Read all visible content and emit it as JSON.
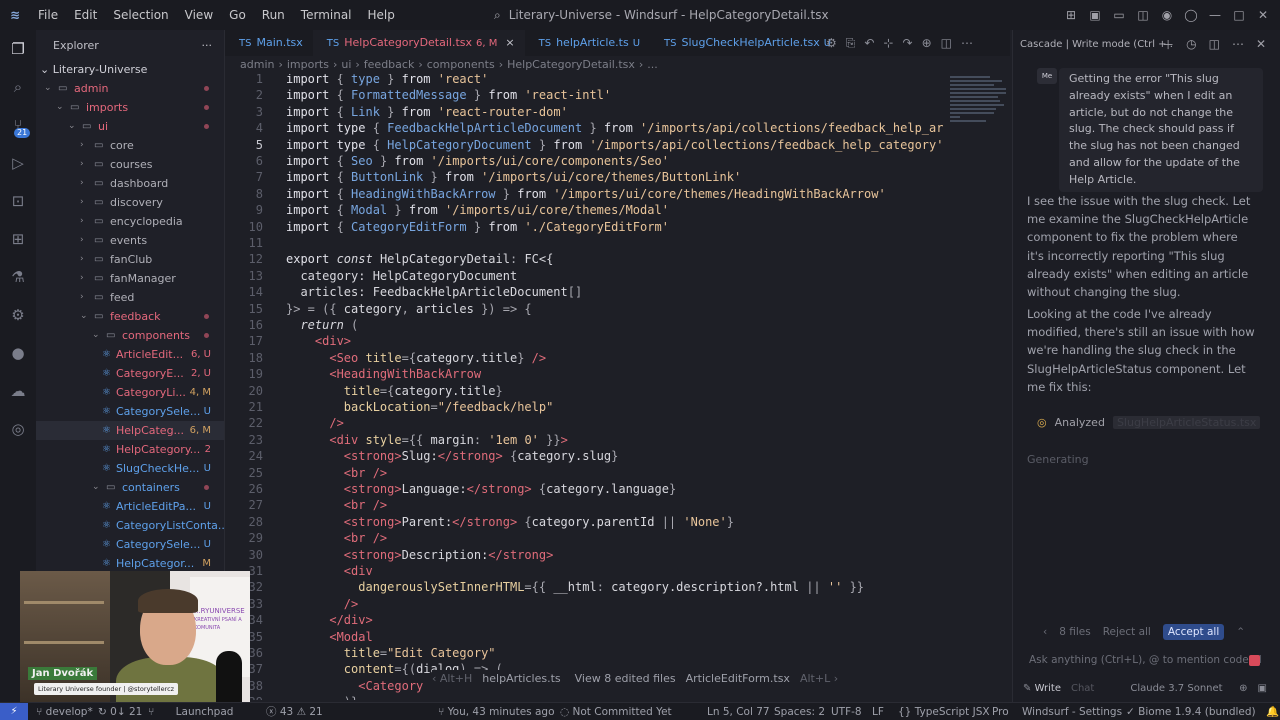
{
  "titlebar": {
    "menu": [
      "File",
      "Edit",
      "Selection",
      "View",
      "Go",
      "Run",
      "Terminal",
      "Help"
    ],
    "window_title": "Literary-Universe - Windsurf - HelpCategoryDetail.tsx"
  },
  "activity_bar": {
    "icons": [
      "explorer-icon",
      "search-icon",
      "source-control-icon",
      "run-debug-icon",
      "remote-icon",
      "extensions-icon",
      "testing-icon",
      "windsurf-icon",
      "github-icon",
      "docker-icon",
      "deploy-icon"
    ],
    "scm_badge": "21"
  },
  "sidebar": {
    "title": "Explorer",
    "more": "···",
    "project": "Literary-Universe",
    "tree": [
      {
        "label": "admin",
        "indent": 0,
        "type": "folder",
        "open": true,
        "color": "red",
        "dot": true
      },
      {
        "label": "imports",
        "indent": 1,
        "type": "folder",
        "open": true,
        "color": "red",
        "dot": true
      },
      {
        "label": "ui",
        "indent": 2,
        "type": "folder",
        "open": true,
        "color": "red",
        "dot": true
      },
      {
        "label": "core",
        "indent": 3,
        "type": "folder",
        "open": false,
        "color": "plain",
        "dot": false
      },
      {
        "label": "courses",
        "indent": 3,
        "type": "folder",
        "open": false,
        "color": "plain",
        "dot": false
      },
      {
        "label": "dashboard",
        "indent": 3,
        "type": "folder",
        "open": false,
        "color": "plain",
        "dot": false
      },
      {
        "label": "discovery",
        "indent": 3,
        "type": "folder",
        "open": false,
        "color": "plain",
        "dot": false
      },
      {
        "label": "encyclopedia",
        "indent": 3,
        "type": "folder",
        "open": false,
        "color": "plain",
        "dot": false
      },
      {
        "label": "events",
        "indent": 3,
        "type": "folder",
        "open": false,
        "color": "plain",
        "dot": false
      },
      {
        "label": "fanClub",
        "indent": 3,
        "type": "folder",
        "open": false,
        "color": "plain",
        "dot": false
      },
      {
        "label": "fanManager",
        "indent": 3,
        "type": "folder",
        "open": false,
        "color": "plain",
        "dot": false
      },
      {
        "label": "feed",
        "indent": 3,
        "type": "folder",
        "open": false,
        "color": "plain",
        "dot": false
      },
      {
        "label": "feedback",
        "indent": 3,
        "type": "folder",
        "open": true,
        "color": "red",
        "dot": true
      },
      {
        "label": "components",
        "indent": 4,
        "type": "folder",
        "open": true,
        "color": "red",
        "dot": true
      },
      {
        "label": "ArticleEdit...",
        "indent": 5,
        "type": "file",
        "color": "red",
        "status": "6, U"
      },
      {
        "label": "CategoryE...",
        "indent": 5,
        "type": "file",
        "color": "red",
        "status": "2, U"
      },
      {
        "label": "CategoryLi...",
        "indent": 5,
        "type": "file",
        "color": "red",
        "status": "4, M"
      },
      {
        "label": "CategorySele...",
        "indent": 5,
        "type": "file",
        "color": "blue",
        "status": "U"
      },
      {
        "label": "HelpCateg...",
        "indent": 5,
        "type": "file",
        "color": "red",
        "status": "6, M",
        "selected": true
      },
      {
        "label": "HelpCategory...",
        "indent": 5,
        "type": "file",
        "color": "red",
        "status": "2"
      },
      {
        "label": "SlugCheckHe...",
        "indent": 5,
        "type": "file",
        "color": "blue",
        "status": "U"
      },
      {
        "label": "containers",
        "indent": 4,
        "type": "folder",
        "open": true,
        "color": "blue",
        "dot": true
      },
      {
        "label": "ArticleEditPa...",
        "indent": 5,
        "type": "file",
        "color": "blue",
        "status": "U"
      },
      {
        "label": "CategoryListConta...",
        "indent": 5,
        "type": "file",
        "color": "blue",
        "status": ""
      },
      {
        "label": "CategorySele...",
        "indent": 5,
        "type": "file",
        "color": "blue",
        "status": "U"
      },
      {
        "label": "HelpCategor...",
        "indent": 5,
        "type": "file",
        "color": "blue",
        "status": "M"
      },
      {
        "label": "form",
        "indent": 4,
        "type": "folder",
        "open": false,
        "color": "plain",
        "dot": false
      }
    ]
  },
  "tabs": [
    {
      "label": "Main.tsx",
      "icon": "TS",
      "status": "",
      "active": false,
      "color": "blue"
    },
    {
      "label": "HelpCategoryDetail.tsx",
      "icon": "TS",
      "status": "6, M",
      "active": true,
      "color": "red",
      "close": "×"
    },
    {
      "label": "helpArticle.ts",
      "icon": "TS",
      "status": "U",
      "active": false,
      "color": "blue"
    },
    {
      "label": "SlugCheckHelpArticle.tsx",
      "icon": "TS",
      "status": "U",
      "active": false,
      "color": "blue"
    }
  ],
  "breadcrumb": [
    "admin",
    "imports",
    "ui",
    "feedback",
    "components",
    "HelpCategoryDetail.tsx",
    "..."
  ],
  "code_lines": [
    {
      "n": "1",
      "tokens": [
        [
          "kw",
          "import "
        ],
        [
          "pu",
          "{ "
        ],
        [
          "ty",
          "type"
        ],
        [
          "pu",
          " } "
        ],
        [
          "kw",
          "from "
        ],
        [
          "str",
          "'react'"
        ]
      ]
    },
    {
      "n": "2",
      "tokens": [
        [
          "kw",
          "import "
        ],
        [
          "pu",
          "{ "
        ],
        [
          "ty",
          "FormattedMessage"
        ],
        [
          "pu",
          " } "
        ],
        [
          "kw",
          "from "
        ],
        [
          "str",
          "'react-intl'"
        ]
      ]
    },
    {
      "n": "3",
      "tokens": [
        [
          "kw",
          "import "
        ],
        [
          "pu",
          "{ "
        ],
        [
          "ty",
          "Link"
        ],
        [
          "pu",
          " } "
        ],
        [
          "kw",
          "from "
        ],
        [
          "str",
          "'react-router-dom'"
        ]
      ]
    },
    {
      "n": "4",
      "tokens": [
        [
          "kw",
          "import type "
        ],
        [
          "pu",
          "{ "
        ],
        [
          "ty",
          "FeedbackHelpArticleDocument"
        ],
        [
          "pu",
          " } "
        ],
        [
          "kw",
          "from "
        ],
        [
          "str",
          "'/imports/api/collections/feedback_help_ar"
        ]
      ]
    },
    {
      "n": "5",
      "tokens": [
        [
          "kw",
          "import type "
        ],
        [
          "pu",
          "{ "
        ],
        [
          "ty",
          "HelpCategoryDocument"
        ],
        [
          "pu",
          " } "
        ],
        [
          "kw",
          "from "
        ],
        [
          "str",
          "'/imports/api/collections/feedback_help_category'"
        ]
      ],
      "cur": true
    },
    {
      "n": "6",
      "tokens": [
        [
          "kw",
          "import "
        ],
        [
          "pu",
          "{ "
        ],
        [
          "ty",
          "Seo"
        ],
        [
          "pu",
          " } "
        ],
        [
          "kw",
          "from "
        ],
        [
          "str",
          "'/imports/ui/core/components/Seo'"
        ]
      ]
    },
    {
      "n": "7",
      "tokens": [
        [
          "kw",
          "import "
        ],
        [
          "pu",
          "{ "
        ],
        [
          "ty",
          "ButtonLink"
        ],
        [
          "pu",
          " } "
        ],
        [
          "kw",
          "from "
        ],
        [
          "str",
          "'/imports/ui/core/themes/ButtonLink'"
        ]
      ]
    },
    {
      "n": "8",
      "tokens": [
        [
          "kw",
          "import "
        ],
        [
          "pu",
          "{ "
        ],
        [
          "ty",
          "HeadingWithBackArrow"
        ],
        [
          "pu",
          " } "
        ],
        [
          "kw",
          "from "
        ],
        [
          "str",
          "'/imports/ui/core/themes/HeadingWithBackArrow'"
        ]
      ]
    },
    {
      "n": "9",
      "tokens": [
        [
          "kw",
          "import "
        ],
        [
          "pu",
          "{ "
        ],
        [
          "ty",
          "Modal"
        ],
        [
          "pu",
          " } "
        ],
        [
          "kw",
          "from "
        ],
        [
          "str",
          "'/imports/ui/core/themes/Modal'"
        ]
      ]
    },
    {
      "n": "10",
      "tokens": [
        [
          "kw",
          "import "
        ],
        [
          "pu",
          "{ "
        ],
        [
          "ty",
          "CategoryEditForm"
        ],
        [
          "pu",
          " } "
        ],
        [
          "kw",
          "from "
        ],
        [
          "str",
          "'./CategoryEditForm'"
        ]
      ]
    },
    {
      "n": "11",
      "tokens": []
    },
    {
      "n": "12",
      "tokens": [
        [
          "kw",
          "export "
        ],
        [
          "ital",
          "const "
        ],
        [
          "pl",
          "HelpCategoryDetail"
        ],
        [
          "pu",
          ": "
        ],
        [
          "pl",
          "FC<{"
        ]
      ]
    },
    {
      "n": "13",
      "tokens": [
        [
          "pl",
          "  category: HelpCategoryDocument"
        ]
      ]
    },
    {
      "n": "14",
      "tokens": [
        [
          "pl",
          "  articles: FeedbackHelpArticleDocument"
        ],
        [
          "pu",
          "[]"
        ]
      ]
    },
    {
      "n": "15",
      "tokens": [
        [
          "pu",
          "}> = ({ "
        ],
        [
          "pl",
          "category"
        ],
        [
          "pu",
          ", "
        ],
        [
          "pl",
          "articles"
        ],
        [
          "pu",
          " }) => {"
        ]
      ]
    },
    {
      "n": "16",
      "tokens": [
        [
          "ital",
          "  return "
        ],
        [
          "pu",
          "("
        ]
      ]
    },
    {
      "n": "17",
      "tokens": [
        [
          "tg",
          "    <div"
        ],
        [
          "tg",
          ">"
        ]
      ]
    },
    {
      "n": "18",
      "tokens": [
        [
          "tg",
          "      <Seo "
        ],
        [
          "at",
          "title"
        ],
        [
          "pu",
          "={"
        ],
        [
          "pl",
          "category.title"
        ],
        [
          "pu",
          "} "
        ],
        [
          "tg",
          "/>"
        ]
      ]
    },
    {
      "n": "19",
      "tokens": [
        [
          "tg",
          "      <HeadingWithBackArrow"
        ]
      ]
    },
    {
      "n": "20",
      "tokens": [
        [
          "at",
          "        title"
        ],
        [
          "pu",
          "={"
        ],
        [
          "pl",
          "category.title"
        ],
        [
          "pu",
          "}"
        ]
      ]
    },
    {
      "n": "21",
      "tokens": [
        [
          "at",
          "        backLocation"
        ],
        [
          "pu",
          "="
        ],
        [
          "str",
          "\"/feedback/help\""
        ]
      ]
    },
    {
      "n": "22",
      "tokens": [
        [
          "tg",
          "      />"
        ]
      ]
    },
    {
      "n": "23",
      "tokens": [
        [
          "tg",
          "      <div "
        ],
        [
          "at",
          "style"
        ],
        [
          "pu",
          "={{ "
        ],
        [
          "pl",
          "margin"
        ],
        [
          "pu",
          ": "
        ],
        [
          "str",
          "'1em 0'"
        ],
        [
          "pu",
          " }}"
        ],
        [
          "tg",
          ">"
        ]
      ]
    },
    {
      "n": "24",
      "tokens": [
        [
          "tg",
          "        <strong>"
        ],
        [
          "pl",
          "Slug:"
        ],
        [
          "tg",
          "</strong>"
        ],
        [
          "pu",
          " {"
        ],
        [
          "pl",
          "category.slug"
        ],
        [
          "pu",
          "}"
        ]
      ]
    },
    {
      "n": "25",
      "tokens": [
        [
          "tg",
          "        <br />"
        ]
      ]
    },
    {
      "n": "26",
      "tokens": [
        [
          "tg",
          "        <strong>"
        ],
        [
          "pl",
          "Language:"
        ],
        [
          "tg",
          "</strong>"
        ],
        [
          "pu",
          " {"
        ],
        [
          "pl",
          "category.language"
        ],
        [
          "pu",
          "}"
        ]
      ]
    },
    {
      "n": "27",
      "tokens": [
        [
          "tg",
          "        <br />"
        ]
      ]
    },
    {
      "n": "28",
      "tokens": [
        [
          "tg",
          "        <strong>"
        ],
        [
          "pl",
          "Parent:"
        ],
        [
          "tg",
          "</strong>"
        ],
        [
          "pu",
          " {"
        ],
        [
          "pl",
          "category.parentId"
        ],
        [
          "pu",
          " || "
        ],
        [
          "str",
          "'None'"
        ],
        [
          "pu",
          "}"
        ]
      ]
    },
    {
      "n": "29",
      "tokens": [
        [
          "tg",
          "        <br />"
        ]
      ]
    },
    {
      "n": "30",
      "tokens": [
        [
          "tg",
          "        <strong>"
        ],
        [
          "pl",
          "Description:"
        ],
        [
          "tg",
          "</strong>"
        ]
      ]
    },
    {
      "n": "31",
      "tokens": [
        [
          "tg",
          "        <div"
        ]
      ]
    },
    {
      "n": "32",
      "tokens": [
        [
          "at",
          "          dangerouslySetInnerHTML"
        ],
        [
          "pu",
          "={{ "
        ],
        [
          "pl",
          "__html"
        ],
        [
          "pu",
          ": "
        ],
        [
          "pl",
          "category.description?.html"
        ],
        [
          "pu",
          " || "
        ],
        [
          "str",
          "''"
        ],
        [
          "pu",
          " }}"
        ]
      ]
    },
    {
      "n": "33",
      "tokens": [
        [
          "tg",
          "        />"
        ]
      ]
    },
    {
      "n": "34",
      "tokens": [
        [
          "tg",
          "      </div>"
        ]
      ]
    },
    {
      "n": "35",
      "tokens": [
        [
          "tg",
          "      <Modal"
        ]
      ]
    },
    {
      "n": "36",
      "tokens": [
        [
          "at",
          "        title"
        ],
        [
          "pu",
          "="
        ],
        [
          "str",
          "\"Edit Category\""
        ]
      ]
    },
    {
      "n": "37",
      "tokens": [
        [
          "at",
          "        content"
        ],
        [
          "pu",
          "={("
        ],
        [
          "pl",
          "dialog"
        ],
        [
          "pu",
          ") => ("
        ]
      ]
    },
    {
      "n": "38",
      "tokens": [
        [
          "tg",
          "          <Category"
        ]
      ]
    },
    {
      "n": "39",
      "tokens": [
        [
          "pu",
          "        )}"
        ]
      ]
    }
  ],
  "inline_hint": {
    "left_shortcut": "Alt+H",
    "file1": "helpArticles.ts",
    "view": "View 8 edited files",
    "file2": "ArticleEditForm.tsx",
    "right_shortcut": "Alt+L"
  },
  "cascade": {
    "header": "Cascade | Write mode (Ctrl + .",
    "user_avatar": "Me",
    "user_message": "Getting the error \"This slug already exists\" when I edit an article, but do not change the slug. The check should pass if the slug has not been changed and allow for the update of the Help Article.",
    "ai_message_1": "I see the issue with the slug check. Let me examine the SlugCheckHelpArticle component to fix the problem where it's incorrectly reporting \"This slug already exists\" when editing an article without changing the slug.",
    "ai_message_2": "Looking at the code I've already modified, there's still an issue with how we're handling the slug check in the SlugHelpArticleStatus component. Let me fix this:",
    "analyzed_label": "Analyzed",
    "analyzed_file": "SlugHelpArticleStatus.tsx",
    "generating": "Generating",
    "files_label": "8 files",
    "reject_all": "Reject all",
    "accept_all": "Accept all",
    "ask_placeholder": "Ask anything (Ctrl+L), @ to mention code bl",
    "mode": "Write",
    "chat": "Chat",
    "model": "Claude 3.7 Sonnet"
  },
  "webcam": {
    "name": "Jan Dvořák",
    "subtitle": "Literary Universe founder | @storytellercz",
    "poster_text": "...RYUNIVERSE",
    "poster_sub": "KREATIVNÍ PSANÍ A KOMUNITA"
  },
  "statusbar": {
    "branch": "develop*",
    "sync": "0↓ 21",
    "launchpad": "Launchpad",
    "errors": "43",
    "warnings": "21",
    "blame": "You, 43 minutes ago",
    "commit": "Not Committed Yet",
    "position": "Ln 5, Col 77",
    "spaces": "Spaces: 2",
    "encoding": "UTF-8",
    "eol": "LF",
    "language": "TypeScript JSX",
    "settings": "Windsurf - Settings",
    "biome": "Biome 1.9.4 (bundled)",
    "plan": "Pro"
  }
}
